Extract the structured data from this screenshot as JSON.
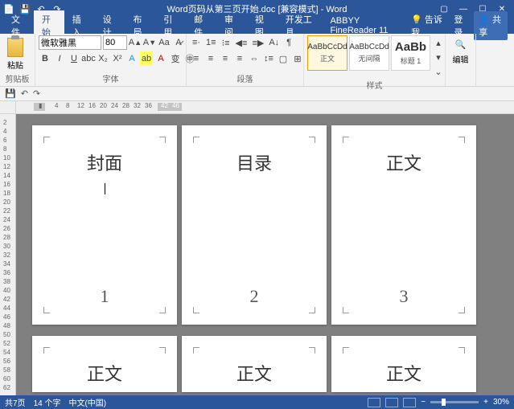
{
  "titlebar": {
    "doc_name": "Word页码从第三页开始.doc [兼容模式] - Word",
    "icons": {
      "save": "💾",
      "undo": "↶",
      "redo": "↷"
    }
  },
  "tabs": {
    "file": "文件",
    "items": [
      "开始",
      "插入",
      "设计",
      "布局",
      "引用",
      "邮件",
      "审阅",
      "视图",
      "开发工具",
      "ABBYY FineReader 11"
    ],
    "active_index": 0,
    "tell_me": "告诉我...",
    "login": "登录",
    "share": "共享"
  },
  "ribbon": {
    "clipboard": {
      "paste": "粘贴",
      "label": "剪贴板"
    },
    "font": {
      "name": "微软雅黑",
      "size": "80",
      "label": "字体",
      "bold": "B",
      "italic": "I",
      "underline": "U"
    },
    "paragraph": {
      "label": "段落"
    },
    "styles": {
      "label": "样式",
      "items": [
        {
          "preview": "AaBbCcDd",
          "name": "正文"
        },
        {
          "preview": "AaBbCcDd",
          "name": "无间隔"
        },
        {
          "preview": "AaBb",
          "name": "标题 1"
        }
      ]
    },
    "editing": {
      "label": "编辑"
    }
  },
  "ruler": {
    "marks": [
      "4",
      "8",
      "12",
      "16",
      "20",
      "24",
      "28",
      "32",
      "36"
    ],
    "tail": [
      "42",
      "46"
    ]
  },
  "vruler": [
    "2",
    "4",
    "6",
    "8",
    "10",
    "12",
    "14",
    "16",
    "18",
    "20",
    "22",
    "24",
    "26",
    "28",
    "30",
    "32",
    "34",
    "36",
    "38",
    "40",
    "42",
    "44",
    "46",
    "48",
    "50",
    "52",
    "54",
    "56",
    "58",
    "60",
    "62"
  ],
  "pages": [
    {
      "title": "封面",
      "num": "1"
    },
    {
      "title": "目录",
      "num": "2"
    },
    {
      "title": "正文",
      "num": "3"
    },
    {
      "title": "正文",
      "num": ""
    },
    {
      "title": "正文",
      "num": ""
    },
    {
      "title": "正文",
      "num": ""
    }
  ],
  "status": {
    "page": "共7页",
    "words": "14 个字",
    "lang": "中文(中国)",
    "zoom": "30%"
  }
}
